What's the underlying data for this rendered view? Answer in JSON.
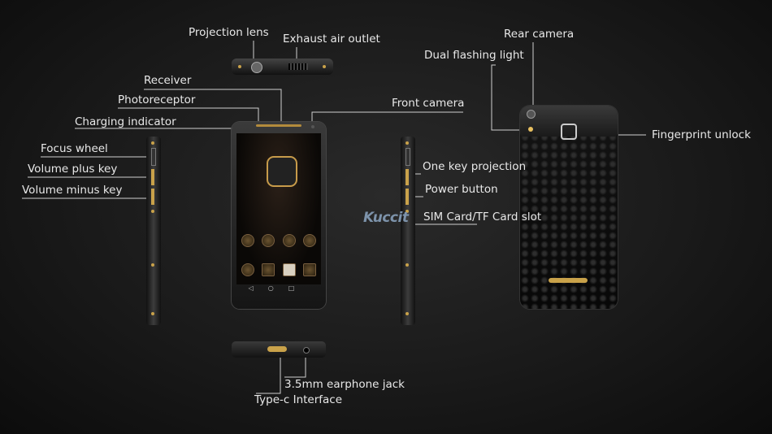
{
  "labels": {
    "projection_lens": "Projection lens",
    "exhaust_air_outlet": "Exhaust air outlet",
    "receiver": "Receiver",
    "photoreceptor": "Photoreceptor",
    "charging_indicator": "Charging indicator",
    "front_camera": "Front camera",
    "focus_wheel": "Focus wheel",
    "volume_plus_key": "Volume plus key",
    "volume_minus_key": "Volume minus key",
    "one_key_projection": "One key projection",
    "power_button": "Power button",
    "sim_tf_slot": "SIM Card/TF Card slot",
    "rear_camera": "Rear camera",
    "dual_flashing_light": "Dual flashing light",
    "fingerprint_unlock": "Fingerprint unlock",
    "earphone_jack": "3.5mm earphone jack",
    "type_c": "Type-c Interface"
  },
  "logo": "Kuccit",
  "colors": {
    "background": "#1a1a1a",
    "accent_gold": "#c9a24a",
    "label_text": "#e8e8e8",
    "logo": "#7d93ab"
  }
}
